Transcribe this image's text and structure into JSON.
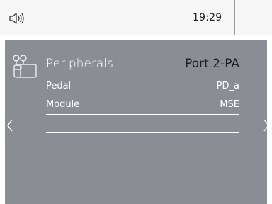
{
  "status_bar": {
    "time": "19:29",
    "speaker_icon": "speaker-icon"
  },
  "panel": {
    "icon": "peripherals-icon",
    "title": "Peripherals",
    "port": "Port 2-PA",
    "rows": [
      {
        "label": "Pedal",
        "value": "PD_a"
      },
      {
        "label": "Module",
        "value": "MSE"
      },
      {
        "label": "",
        "value": ""
      }
    ]
  },
  "navigation": {
    "prev_icon": "chevron-left-icon",
    "next_icon": "chevron-right-icon"
  },
  "colors": {
    "panel_bg": "#8a8d94",
    "topbar_bg": "#f6f6f6",
    "text_light": "#ffffff",
    "text_dark": "#1f1f1f"
  }
}
